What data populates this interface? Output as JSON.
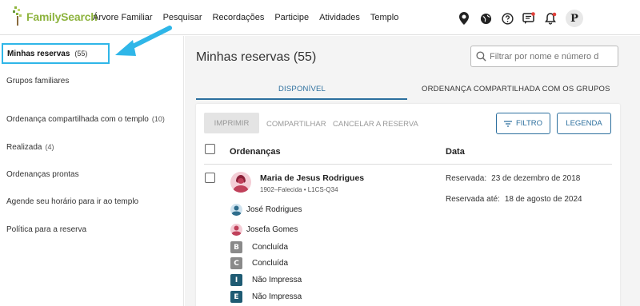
{
  "header": {
    "logo_text": "FamilySearch",
    "nav": [
      "Árvore Familiar",
      "Pesquisar",
      "Recordações",
      "Participe",
      "Atividades",
      "Templo"
    ],
    "avatar_letter": "P",
    "icons": [
      "location-pin-icon",
      "globe-icon",
      "help-icon",
      "messages-icon",
      "notifications-icon"
    ],
    "accent": "#8db33e"
  },
  "sidebar": {
    "active": {
      "label": "Minhas reservas",
      "count": "(55)"
    },
    "items": [
      {
        "label": "Grupos familiares",
        "count": ""
      },
      {
        "label": "Ordenança compartilhada com o templo",
        "count": "(10)"
      },
      {
        "label": "Realizada",
        "count": "(4)"
      },
      {
        "label": "Ordenanças prontas",
        "count": ""
      },
      {
        "label": "Agende seu horário para ir ao templo",
        "count": ""
      },
      {
        "label": "Política para a reserva",
        "count": ""
      }
    ],
    "highlight_color": "#2fb6e8"
  },
  "main": {
    "title": "Minhas reservas (55)",
    "filter_placeholder": "Filtrar por nome e número d",
    "tabs": [
      {
        "label": "DISPONÍVEL",
        "active": true
      },
      {
        "label": "ORDENANÇA COMPARTILHADA COM OS GRUPOS",
        "active": false
      }
    ],
    "toolbar": {
      "print": "IMPRIMIR",
      "share": "COMPARTILHAR",
      "cancel": "CANCELAR A RESERVA",
      "filter": "FILTRO",
      "legend": "LEGENDA"
    },
    "columns": {
      "ordinances": "Ordenanças",
      "date": "Data"
    },
    "row": {
      "name": "Maria de Jesus Rodrigues",
      "meta": "1902–Falecida • L1CS-Q34",
      "reserved_label": "Reservada:",
      "reserved_value": "23 de dezembro de 2018",
      "reserved_until_label": "Reservada até:",
      "reserved_until_value": "18 de agosto de 2024",
      "relatives": [
        {
          "name": "José Rodrigues",
          "gender": "male"
        },
        {
          "name": "Josefa Gomes",
          "gender": "female"
        }
      ],
      "ordinances": [
        {
          "letter": "B",
          "status": "Concluída",
          "color": "#8a8a8a"
        },
        {
          "letter": "C",
          "status": "Concluída",
          "color": "#8a8a8a"
        },
        {
          "letter": "I",
          "status": "Não Impressa",
          "color": "#1f5b73"
        },
        {
          "letter": "E",
          "status": "Não Impressa",
          "color": "#1f5b73"
        }
      ]
    },
    "primary_color": "#2c6f9e"
  }
}
